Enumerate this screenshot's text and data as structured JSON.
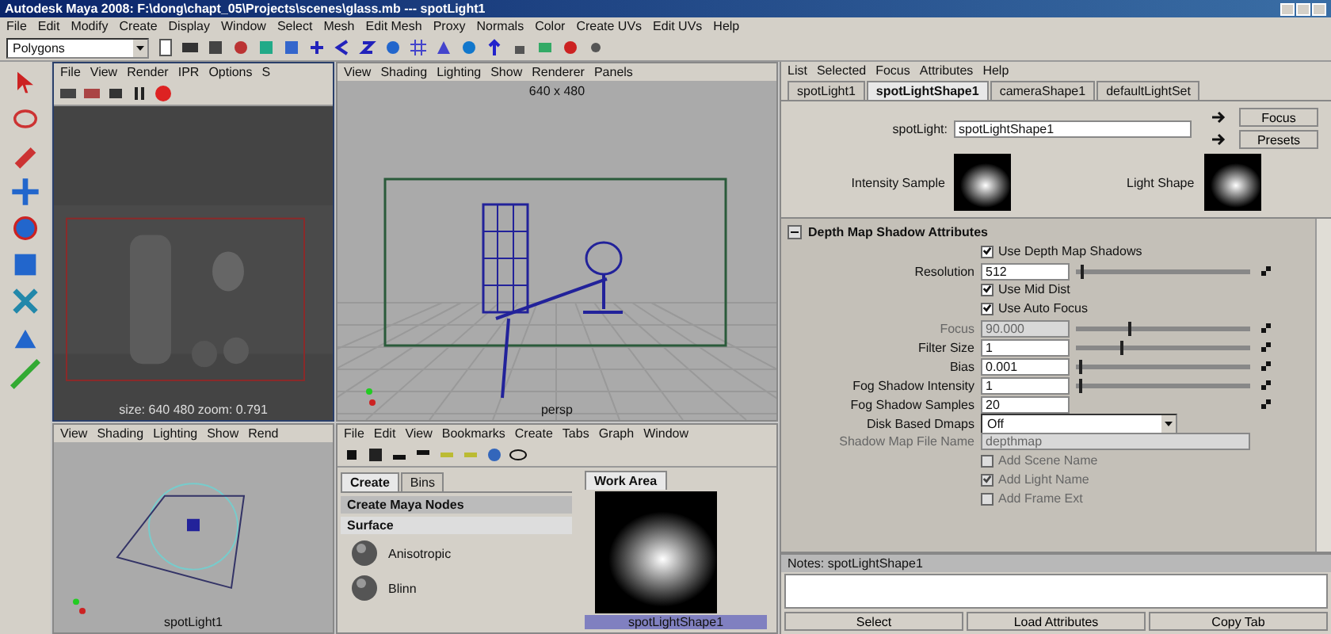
{
  "window": {
    "title": "Autodesk Maya 2008: F:\\dong\\chapt_05\\Projects\\scenes\\glass.mb  ---  spotLight1"
  },
  "menu_bar": [
    "File",
    "Edit",
    "Modify",
    "Create",
    "Display",
    "Window",
    "Select",
    "Mesh",
    "Edit Mesh",
    "Proxy",
    "Normals",
    "Color",
    "Create UVs",
    "Edit UVs",
    "Help"
  ],
  "toolbar": {
    "menu_set": "Polygons"
  },
  "render_view": {
    "menu": [
      "File",
      "View",
      "Render",
      "IPR",
      "Options",
      "S"
    ],
    "status": "size:  640  480  zoom: 0.791"
  },
  "persp_view": {
    "menu": [
      "View",
      "Shading",
      "Lighting",
      "Show",
      "Renderer",
      "Panels"
    ],
    "resolution": "640 x 480",
    "camera": "persp"
  },
  "top_view": {
    "menu": [
      "View",
      "Shading",
      "Lighting",
      "Show",
      "Rend"
    ],
    "object_label": "spotLight1"
  },
  "hypershade": {
    "menu": [
      "File",
      "Edit",
      "View",
      "Bookmarks",
      "Create",
      "Tabs",
      "Graph",
      "Window"
    ],
    "tabs": [
      {
        "label": "Create",
        "selected": true
      },
      {
        "label": "Bins",
        "selected": false
      }
    ],
    "node_header": "Create Maya Nodes",
    "category": "Surface",
    "nodes": [
      "Anisotropic",
      "Blinn"
    ],
    "work_tab": "Work Area",
    "swatch_label": "spotLightShape1"
  },
  "attribute_editor": {
    "menu": [
      "List",
      "Selected",
      "Focus",
      "Attributes",
      "Help"
    ],
    "tabs": [
      {
        "label": "spotLight1",
        "selected": false
      },
      {
        "label": "spotLightShape1",
        "selected": true
      },
      {
        "label": "cameraShape1",
        "selected": false
      },
      {
        "label": "defaultLightSet",
        "selected": false
      }
    ],
    "node_label": "spotLight:",
    "node_name": "spotLightShape1",
    "buttons": [
      "Focus",
      "Presets"
    ],
    "swatches": [
      "Intensity Sample",
      "Light Shape"
    ],
    "section": {
      "title": "Depth Map Shadow Attributes",
      "expanded": true,
      "rows": [
        {
          "kind": "checkbox",
          "label": "Use Depth Map Shadows",
          "checked": true,
          "disabled": false
        },
        {
          "kind": "slider",
          "label": "Resolution",
          "value": "512",
          "level": 0.03,
          "disabled": false,
          "map": true
        },
        {
          "kind": "checkbox",
          "label": "Use Mid Dist",
          "checked": true,
          "disabled": false
        },
        {
          "kind": "checkbox",
          "label": "Use Auto Focus",
          "checked": true,
          "disabled": false
        },
        {
          "kind": "slider",
          "label": "Focus",
          "value": "90.000",
          "level": 0.3,
          "disabled": true,
          "map": true
        },
        {
          "kind": "slider",
          "label": "Filter Size",
          "value": "1",
          "level": 0.25,
          "disabled": false,
          "map": true
        },
        {
          "kind": "slider",
          "label": "Bias",
          "value": "0.001",
          "level": 0.02,
          "disabled": false,
          "map": true
        },
        {
          "kind": "slider",
          "label": "Fog Shadow Intensity",
          "value": "1",
          "level": 0.02,
          "disabled": false,
          "map": true
        },
        {
          "kind": "field",
          "label": "Fog Shadow Samples",
          "value": "20",
          "disabled": false,
          "map": true
        },
        {
          "kind": "dropdown",
          "label": "Disk Based Dmaps",
          "value": "Off",
          "disabled": false
        },
        {
          "kind": "field",
          "label": "Shadow Map File Name",
          "value": "depthmap",
          "disabled": true
        },
        {
          "kind": "checkbox",
          "label": "Add Scene Name",
          "checked": false,
          "disabled": true
        },
        {
          "kind": "checkbox",
          "label": "Add Light Name",
          "checked": true,
          "disabled": true
        },
        {
          "kind": "checkbox",
          "label": "Add Frame Ext",
          "checked": false,
          "disabled": true
        }
      ]
    },
    "notes_label": "Notes:  spotLightShape1",
    "bottom_buttons": [
      "Select",
      "Load Attributes",
      "Copy Tab"
    ]
  }
}
